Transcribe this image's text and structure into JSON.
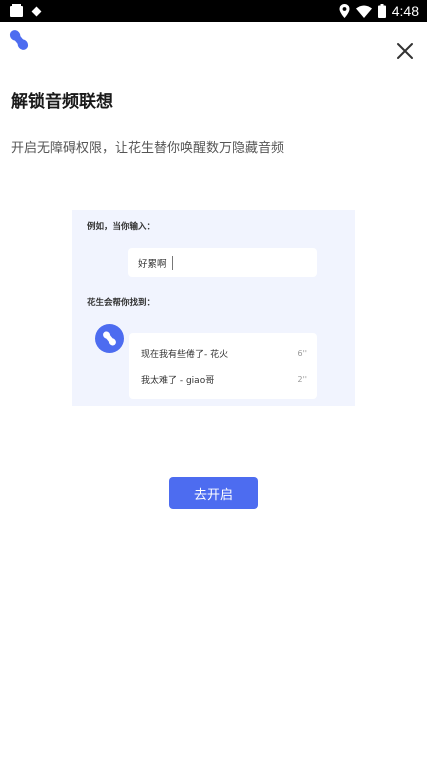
{
  "status_bar": {
    "time": "4:48",
    "icons": [
      "sim-card-icon",
      "diamond-icon",
      "location-pin-icon",
      "wifi-icon",
      "battery-icon"
    ]
  },
  "header": {
    "logo_icon": "peanut-logo-icon",
    "close_icon": "close-icon"
  },
  "main": {
    "title": "解锁音频联想",
    "subtitle": "开启无障碍权限，让花生替你唤醒数万隐藏音频"
  },
  "demo": {
    "example_label": "例如，当你输入：",
    "input_text": "好累啊",
    "found_label": "花生会帮你找到：",
    "results": [
      {
        "title": "现在我有些倦了- 花火",
        "duration": "6''"
      },
      {
        "title": "我太难了 - giao哥",
        "duration": "2''"
      }
    ]
  },
  "actions": {
    "open_label": "去开启"
  },
  "colors": {
    "accent": "#4d6cf0",
    "card_background": "#f1f4fe",
    "status_bar": "#000000"
  }
}
